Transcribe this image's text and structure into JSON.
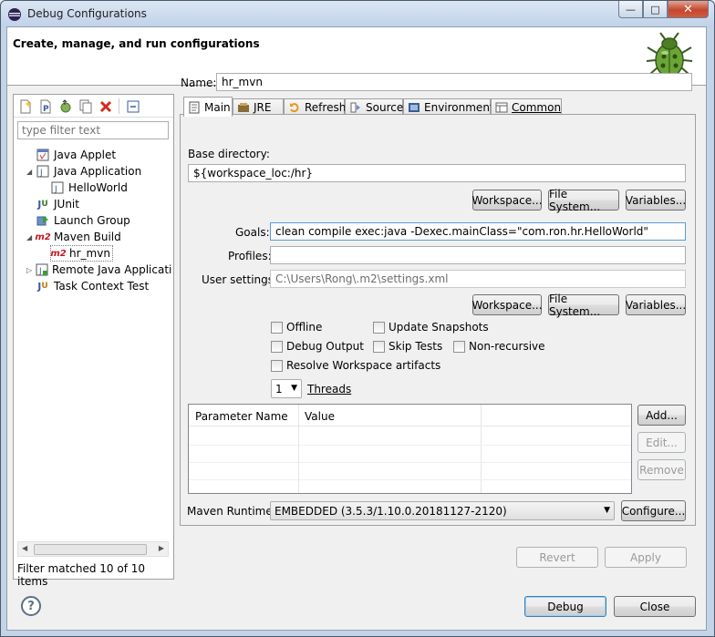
{
  "window": {
    "title": "Debug Configurations",
    "minimize": "—",
    "maximize": "□",
    "close": "✕"
  },
  "header": {
    "title": "Create, manage, and run configurations",
    "icon": "bug-icon"
  },
  "left": {
    "filter_placeholder": "type filter text",
    "tree": [
      {
        "label": "Java Applet",
        "icon": "java-applet-icon"
      },
      {
        "label": "Java Application",
        "icon": "java-application-icon"
      },
      {
        "label": "HelloWorld",
        "icon": "java-launch-icon"
      },
      {
        "label": "JUnit",
        "icon": "junit-icon"
      },
      {
        "label": "Launch Group",
        "icon": "launch-group-icon"
      },
      {
        "label": "Maven Build",
        "icon": "maven-icon"
      },
      {
        "label": "hr_mvn",
        "icon": "maven-icon"
      },
      {
        "label": "Remote Java Application",
        "icon": "remote-java-icon"
      },
      {
        "label": "Task Context Test",
        "icon": "task-context-icon"
      }
    ],
    "status": "Filter matched 10 of 10 items"
  },
  "config": {
    "name_label": "Name:",
    "name_value": "hr_mvn",
    "tabs": [
      {
        "label": "Main",
        "icon": "main-tab-icon"
      },
      {
        "label": "JRE",
        "icon": "jre-tab-icon"
      },
      {
        "label": "Refresh",
        "icon": "refresh-tab-icon"
      },
      {
        "label": "Source",
        "icon": "source-tab-icon"
      },
      {
        "label": "Environment",
        "icon": "environment-tab-icon"
      },
      {
        "label": "Common",
        "icon": "common-tab-icon"
      }
    ],
    "base_dir_label": "Base directory:",
    "base_dir_value": "${workspace_loc:/hr}",
    "workspace_btn": "Workspace...",
    "filesystem_btn": "File System...",
    "variables_btn": "Variables...",
    "goals_label": "Goals:",
    "goals_value": "clean compile exec:java -Dexec.mainClass=\"com.ron.hr.HelloWorld\"",
    "profiles_label": "Profiles:",
    "profiles_value": "",
    "user_settings_label": "User settings:",
    "user_settings_value": "C:\\Users\\Rong\\.m2\\settings.xml",
    "checkboxes": {
      "offline": "Offline",
      "update_snapshots": "Update Snapshots",
      "debug_output": "Debug Output",
      "skip_tests": "Skip Tests",
      "non_recursive": "Non-recursive",
      "resolve_workspace": "Resolve Workspace artifacts"
    },
    "threads_value": "1",
    "threads_label": "Threads",
    "table": {
      "col1": "Parameter Name",
      "col2": "Value"
    },
    "add_btn": "Add...",
    "edit_btn": "Edit...",
    "remove_btn": "Remove",
    "runtime_label": "Maven Runtime:",
    "runtime_value": "EMBEDDED (3.5.3/1.10.0.20181127-2120)",
    "configure_btn": "Configure...",
    "revert_btn": "Revert",
    "apply_btn": "Apply"
  },
  "footer": {
    "debug_btn": "Debug",
    "close_btn": "Close",
    "help": "?"
  }
}
